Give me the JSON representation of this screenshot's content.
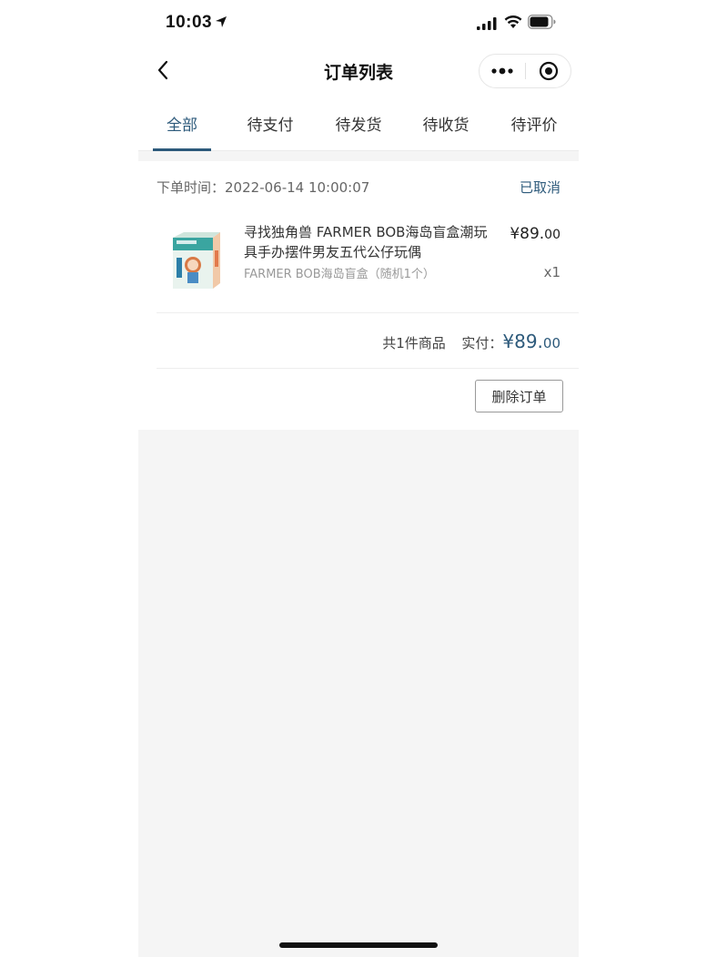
{
  "status_bar": {
    "time": "10:03"
  },
  "nav": {
    "title": "订单列表"
  },
  "tabs": [
    {
      "label": "全部",
      "active": true
    },
    {
      "label": "待支付",
      "active": false
    },
    {
      "label": "待发货",
      "active": false
    },
    {
      "label": "待收货",
      "active": false
    },
    {
      "label": "待评价",
      "active": false
    }
  ],
  "order": {
    "time_label": "下单时间：",
    "time_value": "2022-06-14 10:00:07",
    "status": "已取消",
    "product": {
      "title": "寻找独角兽 FARMER BOB海岛盲盒潮玩具手办摆件男友五代公仔玩偶",
      "spec": "FARMER BOB海岛盲盒（随机1个）",
      "price_main": "¥89.",
      "price_cents": "00",
      "qty": "x1"
    },
    "summary": {
      "count_text": "共1件商品",
      "paid_label": "实付：",
      "paid_main": "¥89.",
      "paid_cents": "00"
    },
    "delete_label": "删除订单"
  },
  "colors": {
    "accent": "#2d5a7b",
    "page_bg": "#f5f5f5"
  }
}
